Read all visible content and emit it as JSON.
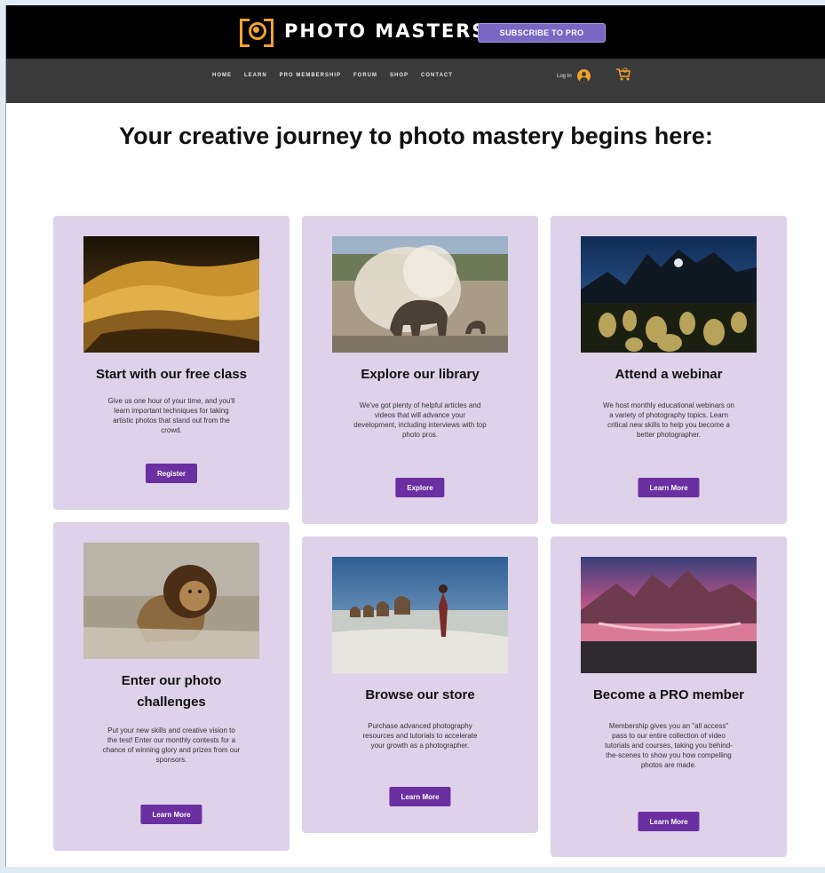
{
  "header": {
    "brand_name": "PHOTO MASTERS",
    "subscribe_label": "SUBSCRIBE TO PRO",
    "accent_color": "#f0a32a"
  },
  "nav": {
    "items": [
      "HOME",
      "LEARN",
      "PRO MEMBERSHIP",
      "FORUM",
      "SHOP",
      "CONTACT"
    ],
    "login_label": "Log In"
  },
  "main": {
    "headline": "Your creative journey to photo mastery begins here:"
  },
  "cards": [
    {
      "title": "Start with our free class",
      "text": "Give us one hour of your time, and you'll learn important techniques for taking artistic photos that stand out from the crowd.",
      "button": "Register",
      "image": "desert-dunes-photo"
    },
    {
      "title": "Explore our library",
      "text": "We've got plenty of helpful articles and videos that will advance your development, including interviews with top photo pros.",
      "button": "Explore",
      "image": "elephant-dust-photo"
    },
    {
      "title": "Attend a webinar",
      "text": "We host monthly educational webinars on a variety of photography topics. Learn critical new skills to help you become a better photographer.",
      "button": "Learn More",
      "image": "cactus-night-photo"
    },
    {
      "title": "Enter our photo challenges",
      "text": "Put your new skills and creative vision to the test! Enter our monthly contests for a chance of winning glory and prizes from our sponsors.",
      "button": "Learn More",
      "image": "lion-grass-photo"
    },
    {
      "title": "Browse our store",
      "text": "Purchase advanced photography resources and tutorials to accelerate your growth as a photographer.",
      "button": "Learn More",
      "image": "camel-caravan-photo"
    },
    {
      "title": "Become a PRO member",
      "text": "Membership gives you an \"all access\" pass to our entire collection of video tutorials and courses, taking you behind-the-scenes to show you how compelling photos are made.",
      "button": "Learn More",
      "image": "mountain-lake-photo"
    }
  ]
}
